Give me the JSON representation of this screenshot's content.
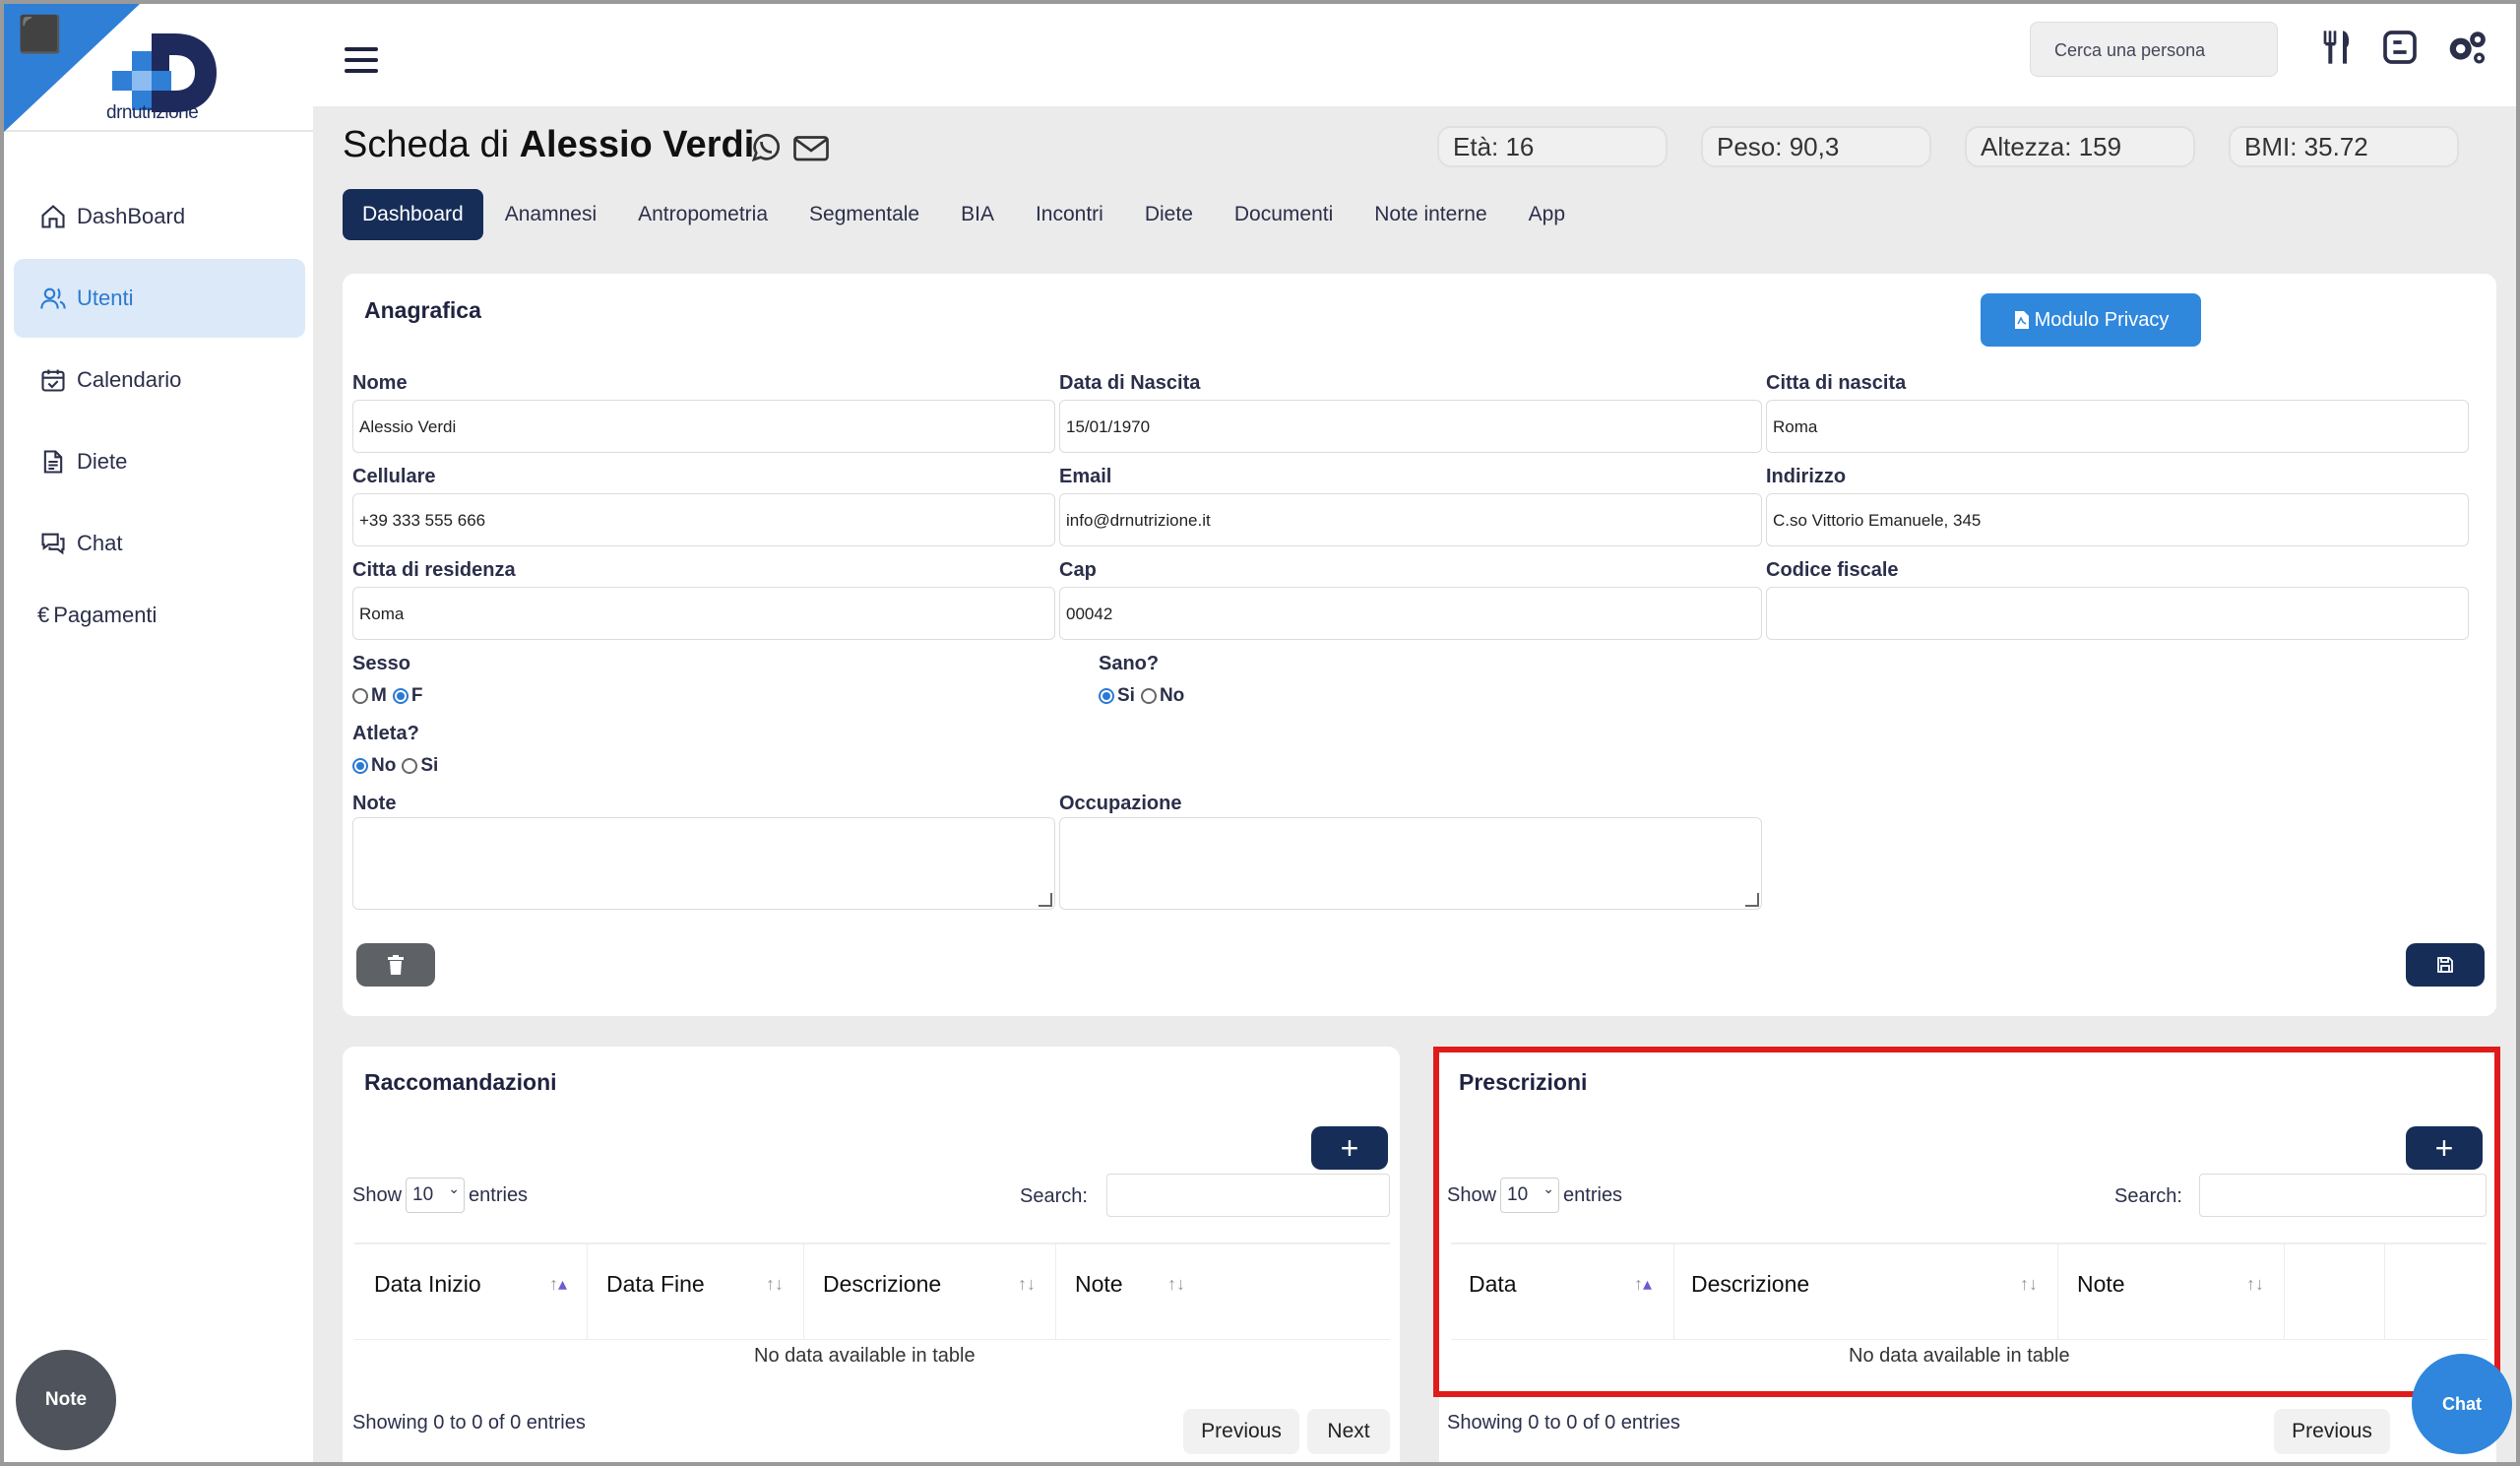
{
  "brand": {
    "logo_text": "drnutrizione"
  },
  "sidebar": {
    "items": [
      {
        "label": "DashBoard",
        "icon": "home-icon"
      },
      {
        "label": "Utenti",
        "icon": "users-icon",
        "active": true
      },
      {
        "label": "Calendario",
        "icon": "calendar-icon"
      },
      {
        "label": "Diete",
        "icon": "document-icon"
      },
      {
        "label": "Chat",
        "icon": "chat-icon"
      },
      {
        "label": "Pagamenti",
        "icon": "euro-icon"
      }
    ],
    "note_button": "Note"
  },
  "topbar": {
    "search_placeholder": "Cerca una persona"
  },
  "header": {
    "title_prefix": "Scheda di",
    "title_name": "Alessio Verdi",
    "stats": {
      "eta": "Età: 16",
      "peso": "Peso: 90,3",
      "altezza": "Altezza: 159",
      "bmi": "BMI: 35.72"
    }
  },
  "tabs": [
    "Dashboard",
    "Anamnesi",
    "Antropometria",
    "Segmentale",
    "BIA",
    "Incontri",
    "Diete",
    "Documenti",
    "Note interne",
    "App"
  ],
  "anagrafica": {
    "title": "Anagrafica",
    "privacy_button": "Modulo Privacy",
    "fields": {
      "nome": {
        "label": "Nome",
        "value": "Alessio Verdi"
      },
      "data_nascita": {
        "label": "Data di Nascita",
        "value": "15/01/1970"
      },
      "citta_nascita": {
        "label": "Citta di nascita",
        "value": "Roma"
      },
      "cellulare": {
        "label": "Cellulare",
        "value": "+39 333 555 666"
      },
      "email": {
        "label": "Email",
        "value": "info@drnutrizione.it"
      },
      "indirizzo": {
        "label": "Indirizzo",
        "value": "C.so Vittorio Emanuele, 345"
      },
      "citta_residenza": {
        "label": "Citta di residenza",
        "value": "Roma"
      },
      "cap": {
        "label": "Cap",
        "value": "00042"
      },
      "codice_fiscale": {
        "label": "Codice fiscale",
        "value": ""
      }
    },
    "sesso": {
      "label": "Sesso",
      "opt1": "M",
      "opt2": "F",
      "selected": "F"
    },
    "sano": {
      "label": "Sano?",
      "opt1": "Si",
      "opt2": "No",
      "selected": "Si"
    },
    "atleta": {
      "label": "Atleta?",
      "opt1": "No",
      "opt2": "Si",
      "selected": "No"
    },
    "note_label": "Note",
    "occupazione_label": "Occupazione"
  },
  "raccomandazioni": {
    "title": "Raccomandazioni",
    "show": "Show",
    "entries_value": "10",
    "entries": "entries",
    "search": "Search:",
    "columns": [
      "Data Inizio",
      "Data Fine",
      "Descrizione",
      "Note"
    ],
    "empty": "No data available in table",
    "info": "Showing 0 to 0 of 0 entries",
    "previous": "Previous",
    "next": "Next"
  },
  "prescrizioni": {
    "title": "Prescrizioni",
    "show": "Show",
    "entries_value": "10",
    "entries": "entries",
    "search": "Search:",
    "columns": [
      "Data",
      "Descrizione",
      "Note"
    ],
    "empty": "No data available in table",
    "info": "Showing 0 to 0 of 0 entries",
    "previous": "Previous"
  },
  "chat_button": "Chat",
  "colors": {
    "primary": "#162d58",
    "accent": "#3088dd",
    "highlight": "#e01b1b"
  }
}
